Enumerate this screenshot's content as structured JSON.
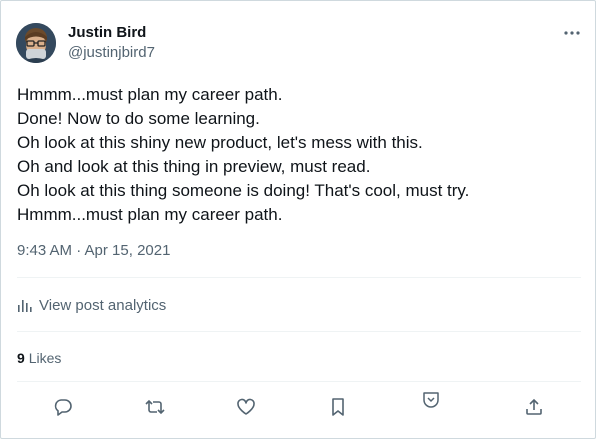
{
  "author": {
    "name": "Justin Bird",
    "handle": "@justinjbird7"
  },
  "post": {
    "lines": [
      "Hmmm...must plan my career path.",
      "Done! Now to do some learning.",
      "Oh look at this shiny new product, let's mess with this.",
      "Oh and look at this thing in preview, must read.",
      "Oh look at this thing someone is doing! That's cool, must try.",
      "Hmmm...must plan my career path."
    ],
    "timestamp": "9:43 AM · Apr 15, 2021"
  },
  "analytics": {
    "label": "View post analytics",
    "icon": "bar-chart-icon"
  },
  "engagement": {
    "likes_count": "9",
    "likes_label": "Likes"
  },
  "actions": {
    "icons": [
      "reply-icon",
      "retweet-icon",
      "like-icon",
      "bookmark-icon",
      "grok-icon",
      "share-icon"
    ]
  },
  "colors": {
    "text_primary": "#0f1419",
    "text_secondary": "#536471",
    "divider": "#eff3f4",
    "border": "#cfd9de"
  }
}
